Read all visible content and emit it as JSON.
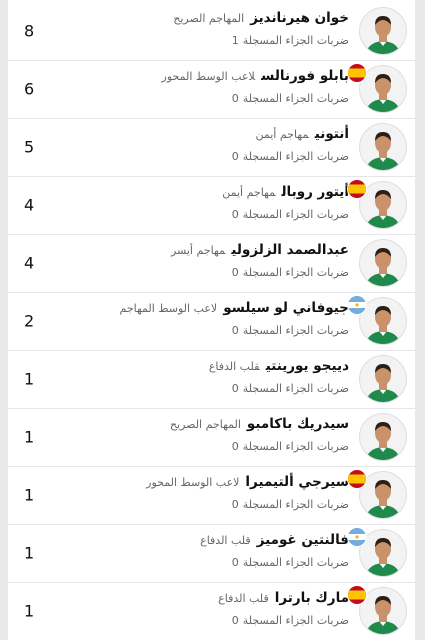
{
  "players": [
    {
      "name": "خوان هيرنانديز",
      "position": "المهاجم الصريح",
      "stat_label": "ضربات الجزاء المسجلة",
      "stat_value": "1",
      "count": "8",
      "flag": "none"
    },
    {
      "name": "بابلو فورنالس",
      "position": "لاعب الوسط المحور",
      "stat_label": "ضربات الجزاء المسجلة",
      "stat_value": "0",
      "count": "6",
      "flag": "spain"
    },
    {
      "name": "أنتوني",
      "position": "مهاجم أيمن",
      "stat_label": "ضربات الجزاء المسجلة",
      "stat_value": "0",
      "count": "5",
      "flag": "none"
    },
    {
      "name": "أيتور روبال",
      "position": "مهاجم أيمن",
      "stat_label": "ضربات الجزاء المسجلة",
      "stat_value": "0",
      "count": "4",
      "flag": "spain"
    },
    {
      "name": "عبدالصمد الزلزولي",
      "position": "مهاجم أيسر",
      "stat_label": "ضربات الجزاء المسجلة",
      "stat_value": "0",
      "count": "4",
      "flag": "none"
    },
    {
      "name": "جيوفاني لو سيلسو",
      "position": "لاعب الوسط المهاجم",
      "stat_label": "ضربات الجزاء المسجلة",
      "stat_value": "0",
      "count": "2",
      "flag": "argentina"
    },
    {
      "name": "دييجو يورينتي",
      "position": "قلب الدفاع",
      "stat_label": "ضربات الجزاء المسجلة",
      "stat_value": "0",
      "count": "1",
      "flag": "none"
    },
    {
      "name": "سيدريك باكامبو",
      "position": "المهاجم الصريح",
      "stat_label": "ضربات الجزاء المسجلة",
      "stat_value": "0",
      "count": "1",
      "flag": "none"
    },
    {
      "name": "سيرجي ألتيميرا",
      "position": "لاعب الوسط المحور",
      "stat_label": "ضربات الجزاء المسجلة",
      "stat_value": "0",
      "count": "1",
      "flag": "spain"
    },
    {
      "name": "فالنتين غوميز",
      "position": "قلب الدفاع",
      "stat_label": "ضربات الجزاء المسجلة",
      "stat_value": "0",
      "count": "1",
      "flag": "argentina"
    },
    {
      "name": "مارك بارترا",
      "position": "قلب الدفاع",
      "stat_label": "ضربات الجزاء المسجلة",
      "stat_value": "0",
      "count": "1",
      "flag": "spain"
    }
  ],
  "colors": {
    "kit_green": "#1f8a4c",
    "skin": "#c9926b",
    "hair": "#2a2018"
  }
}
